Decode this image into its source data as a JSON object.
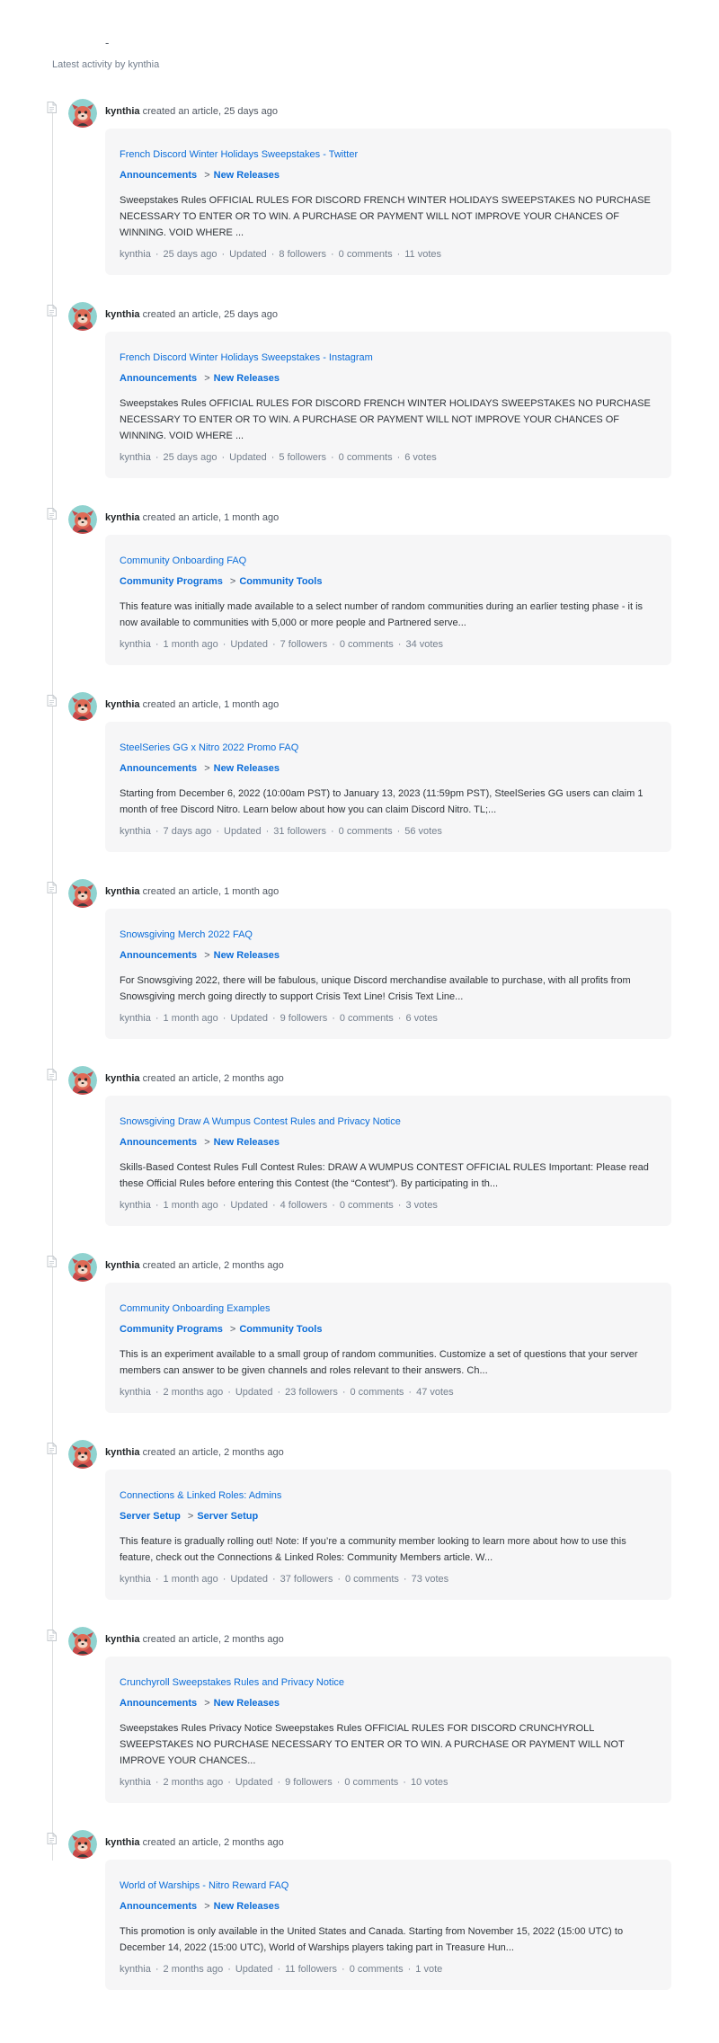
{
  "header": {
    "dash": "-",
    "heading": "Latest activity by kynthia"
  },
  "labels": {
    "updated": "Updated"
  },
  "entries": [
    {
      "author": "kynthia",
      "action": "created an article, 25 days ago",
      "title": "French Discord Winter Holidays Sweepstakes - Twitter",
      "crumb1": "Announcements",
      "sep": ">",
      "crumb2": "New Releases",
      "excerpt": "Sweepstakes Rules OFFICIAL RULES FOR DISCORD FRENCH WINTER HOLIDAYS SWEEPSTAKES NO PURCHASE NECESSARY TO ENTER OR TO WIN. A PURCHASE OR PAYMENT WILL NOT IMPROVE YOUR CHANCES OF WINNING. VOID WHERE ...",
      "meta_author": "kynthia",
      "age": "25 days ago",
      "followers": "8 followers",
      "comments": "0 comments",
      "votes": "11 votes"
    },
    {
      "author": "kynthia",
      "action": "created an article, 25 days ago",
      "title": "French Discord Winter Holidays Sweepstakes - Instagram",
      "crumb1": "Announcements",
      "sep": ">",
      "crumb2": "New Releases",
      "excerpt": "Sweepstakes Rules OFFICIAL RULES FOR DISCORD FRENCH WINTER HOLIDAYS SWEEPSTAKES NO PURCHASE NECESSARY TO ENTER OR TO WIN. A PURCHASE OR PAYMENT WILL NOT IMPROVE YOUR CHANCES OF WINNING. VOID WHERE ...",
      "meta_author": "kynthia",
      "age": "25 days ago",
      "followers": "5 followers",
      "comments": "0 comments",
      "votes": "6 votes"
    },
    {
      "author": "kynthia",
      "action": "created an article, 1 month ago",
      "title": "Community Onboarding FAQ",
      "crumb1": "Community Programs",
      "sep": ">",
      "crumb2": "Community Tools",
      "excerpt": "This feature was initially made available to a select number of random communities during an earlier testing phase - it is now available to communities with 5,000 or more people and Partnered serve...",
      "meta_author": "kynthia",
      "age": "1 month ago",
      "followers": "7 followers",
      "comments": "0 comments",
      "votes": "34 votes"
    },
    {
      "author": "kynthia",
      "action": "created an article, 1 month ago",
      "title": "SteelSeries GG x Nitro 2022 Promo FAQ",
      "crumb1": "Announcements",
      "sep": ">",
      "crumb2": "New Releases",
      "excerpt": "Starting from December 6, 2022 (10:00am PST) to January 13, 2023 (11:59pm PST), SteelSeries GG users can claim 1 month of free Discord Nitro. Learn below about how you can claim Discord Nitro. TL;...",
      "meta_author": "kynthia",
      "age": "7 days ago",
      "followers": "31 followers",
      "comments": "0 comments",
      "votes": "56 votes"
    },
    {
      "author": "kynthia",
      "action": "created an article, 1 month ago",
      "title": "Snowsgiving Merch 2022 FAQ",
      "crumb1": "Announcements",
      "sep": ">",
      "crumb2": "New Releases",
      "excerpt": "For Snowsgiving 2022, there will be fabulous, unique Discord merchandise available to purchase, with all profits from Snowsgiving merch going directly to support Crisis Text Line! Crisis Text Line...",
      "meta_author": "kynthia",
      "age": "1 month ago",
      "followers": "9 followers",
      "comments": "0 comments",
      "votes": "6 votes"
    },
    {
      "author": "kynthia",
      "action": "created an article, 2 months ago",
      "title": "Snowsgiving Draw A Wumpus Contest Rules and Privacy Notice",
      "crumb1": "Announcements",
      "sep": ">",
      "crumb2": "New Releases",
      "excerpt": "Skills-Based Contest Rules Full Contest Rules: DRAW A WUMPUS CONTEST OFFICIAL RULES Important:  Please read these Official Rules before entering this Contest (the “Contest”). By participating in th...",
      "meta_author": "kynthia",
      "age": "1 month ago",
      "followers": "4 followers",
      "comments": "0 comments",
      "votes": "3 votes"
    },
    {
      "author": "kynthia",
      "action": "created an article, 2 months ago",
      "title": "Community Onboarding Examples",
      "crumb1": "Community Programs",
      "sep": ">",
      "crumb2": "Community Tools",
      "excerpt": "This is an experiment available to a small group of random communities. Customize a set of questions that your server members can answer to be given channels and roles relevant to their answers. Ch...",
      "meta_author": "kynthia",
      "age": "2 months ago",
      "followers": "23 followers",
      "comments": "0 comments",
      "votes": "47 votes"
    },
    {
      "author": "kynthia",
      "action": "created an article, 2 months ago",
      "title": "Connections & Linked Roles: Admins",
      "crumb1": "Server Setup",
      "sep": ">",
      "crumb2": "Server Setup",
      "excerpt": "This feature is gradually rolling out! Note: If you’re a community member looking to learn more about how to use this feature, check out the Connections & Linked Roles: Community Members article. W...",
      "meta_author": "kynthia",
      "age": "1 month ago",
      "followers": "37 followers",
      "comments": "0 comments",
      "votes": "73 votes"
    },
    {
      "author": "kynthia",
      "action": "created an article, 2 months ago",
      "title": "Crunchyroll Sweepstakes Rules and Privacy Notice",
      "crumb1": "Announcements",
      "sep": ">",
      "crumb2": "New Releases",
      "excerpt": "Sweepstakes Rules Privacy Notice Sweepstakes Rules OFFICIAL RULES FOR DISCORD CRUNCHYROLL SWEEPSTAKES NO PURCHASE NECESSARY TO ENTER OR TO WIN. A PURCHASE OR PAYMENT WILL NOT IMPROVE YOUR CHANCES...",
      "meta_author": "kynthia",
      "age": "2 months ago",
      "followers": "9 followers",
      "comments": "0 comments",
      "votes": "10 votes"
    },
    {
      "author": "kynthia",
      "action": "created an article, 2 months ago",
      "title": "World of Warships - Nitro Reward FAQ",
      "crumb1": "Announcements",
      "sep": ">",
      "crumb2": "New Releases",
      "excerpt": "This promotion is only available in the United States and Canada. Starting from November 15, 2022 (15:00 UTC) to December 14, 2022 (15:00 UTC), World of Warships players taking part in Treasure Hun...",
      "meta_author": "kynthia",
      "age": "2 months ago",
      "followers": "11 followers",
      "comments": "0 comments",
      "votes": "1 vote"
    }
  ]
}
